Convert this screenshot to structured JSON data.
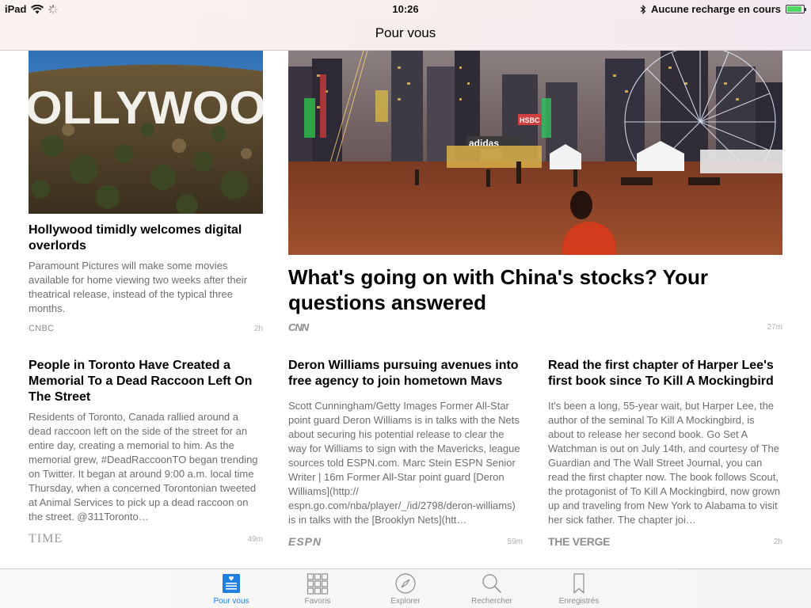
{
  "status_bar": {
    "device": "iPad",
    "time": "10:26",
    "charging": "Aucune recharge en cours",
    "battery_level": 0.9
  },
  "nav": {
    "title": "Pour vous"
  },
  "articles": [
    {
      "headline": "Hollywood timidly welcomes digital overlords",
      "summary": "Paramount Pictures will make some movies available for home viewing two weeks after their theatrical release, instead of the typical three months.",
      "source": "CNBC",
      "time": "2h",
      "image_text": "OLLYWOO"
    },
    {
      "headline": "What's going on with China's stocks? Your questions answered",
      "source": "CNN",
      "time": "27m",
      "image_signs": [
        "adidas",
        "HSBC"
      ]
    },
    {
      "headline": "People in Toronto Have Created a Memorial To a Dead Raccoon Left On The Street",
      "summary": "Residents of Toronto, Canada rallied around a dead raccoon left on the side of the street for an entire day, creating a memorial to him. As the memorial grew, #DeadRaccoonTO began trending on Twitter. It began at around 9:00 a.m. local time Thursday, when a concerned Torontonian tweeted at Animal Services to pick up a dead raccoon on the street. @311Toronto…",
      "source": "TIME",
      "time": "49m"
    },
    {
      "headline": "Deron Williams pursuing avenues into free agency to join hometown Mavs",
      "summary": "Scott Cunningham/Getty Images Former All-Star point guard Deron Williams is in talks with the Nets about securing his potential release to clear the way for Williams to sign with the Mavericks, league sources told ESPN.com. Marc Stein ESPN Senior Writer | 16m Former All-Star point guard [Deron Williams](http:// espn.go.com/nba/player/_/id/2798/deron-williams) is in talks with the [Brooklyn Nets](htt…",
      "source": "ESPN",
      "time": "59m"
    },
    {
      "headline": "Read the first chapter of Harper Lee's first book since To Kill A Mockingbird",
      "summary": "It's been a long, 55-year wait, but Harper Lee, the author of the seminal To Kill A Mockingbird, is about to release her second book. Go Set A Watchman is out on July 14th, and courtesy of The Guardian and The Wall Street Journal, you can read the first chapter now. The book follows Scout, the protagonist of To Kill A Mockingbird, now grown up and traveling from New York to Alabama to visit her sick father. The chapter joi…",
      "source": "THE VERGE",
      "time": "2h"
    }
  ],
  "tabs": [
    {
      "label": "Pour vous",
      "icon": "for-you-icon",
      "active": true
    },
    {
      "label": "Favoris",
      "icon": "favorites-grid-icon",
      "active": false
    },
    {
      "label": "Explorer",
      "icon": "compass-icon",
      "active": false
    },
    {
      "label": "Rechercher",
      "icon": "search-icon",
      "active": false
    },
    {
      "label": "Enregistrés",
      "icon": "bookmark-icon",
      "active": false
    }
  ],
  "colors": {
    "accent": "#1e7fe0",
    "summary_text": "#6e6e6e",
    "battery": "#4cd964"
  }
}
